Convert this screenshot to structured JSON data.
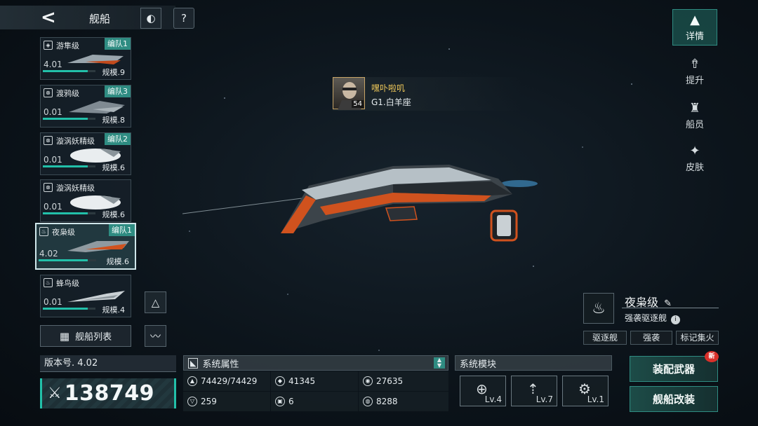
{
  "header": {
    "back_glyph": "<",
    "title": "舰船"
  },
  "top_buttons": [
    {
      "name": "planet-icon",
      "glyph": "🪐"
    },
    {
      "name": "help-icon",
      "glyph": "?"
    }
  ],
  "ship_list": [
    {
      "icon": "shield-icon",
      "name": "游隼级",
      "badge": "编队1",
      "version": "4.01",
      "scale": "规模.9",
      "progress": 0.85
    },
    {
      "icon": "target-icon",
      "name": "渡鸦级",
      "badge": "编队3",
      "version": "0.01",
      "scale": "规模.8",
      "progress": 0.85
    },
    {
      "icon": "target-icon",
      "name": "漩涡妖精级",
      "badge": "编队2",
      "version": "0.01",
      "scale": "规模.6",
      "progress": 0.85
    },
    {
      "icon": "target-icon",
      "name": "漩涡妖精级",
      "badge": "",
      "version": "0.01",
      "scale": "规模.6",
      "progress": 0.85
    },
    {
      "icon": "flame-icon",
      "name": "夜枭级",
      "badge": "编队1",
      "version": "4.02",
      "scale": "规模.6",
      "progress": 0.85,
      "selected": true
    },
    {
      "icon": "flame-icon",
      "name": "蜂鸟级",
      "badge": "",
      "version": "0.01",
      "scale": "规模.4",
      "progress": 0.85
    }
  ],
  "ship_list_button": "舰船列表",
  "version_label": "版本号. 4.02",
  "power_value": "138749",
  "attributes": {
    "title": "系统属性",
    "items": [
      {
        "icon": "hull-icon",
        "value": "74429/74429"
      },
      {
        "icon": "armor-icon",
        "value": "41345"
      },
      {
        "icon": "shield-icon",
        "value": "27635"
      },
      {
        "icon": "speed-icon",
        "value": "259"
      },
      {
        "icon": "checker-icon",
        "value": "6"
      },
      {
        "icon": "energy-icon",
        "value": "8288"
      }
    ]
  },
  "modules": {
    "title": "系统模块",
    "slots": [
      {
        "icon": "crosshair-icon",
        "level": "Lv.4"
      },
      {
        "icon": "missile-icon",
        "level": "Lv.7"
      },
      {
        "icon": "drone-icon",
        "level": "Lv.1"
      }
    ]
  },
  "actions": {
    "equip": "装配武器",
    "modify": "舰船改装",
    "new_badge": "新"
  },
  "side_tabs": [
    {
      "label": "详情",
      "active": true
    },
    {
      "label": "提升"
    },
    {
      "label": "船员"
    },
    {
      "label": "皮肤"
    }
  ],
  "ship_info": {
    "name": "夜枭级",
    "type": "强袭驱逐舰",
    "tags": [
      "驱逐舰",
      "强袭",
      "标记集火"
    ]
  },
  "captain": {
    "name": "嘿卟啦叽",
    "sub": "G1.白羊座",
    "level": "54"
  },
  "colors": {
    "accent": "#22c0a9",
    "badge": "#2f8c82",
    "captain_name": "#f0c95a",
    "new_badge": "#d9302a",
    "ship_orange": "#e0541e"
  }
}
